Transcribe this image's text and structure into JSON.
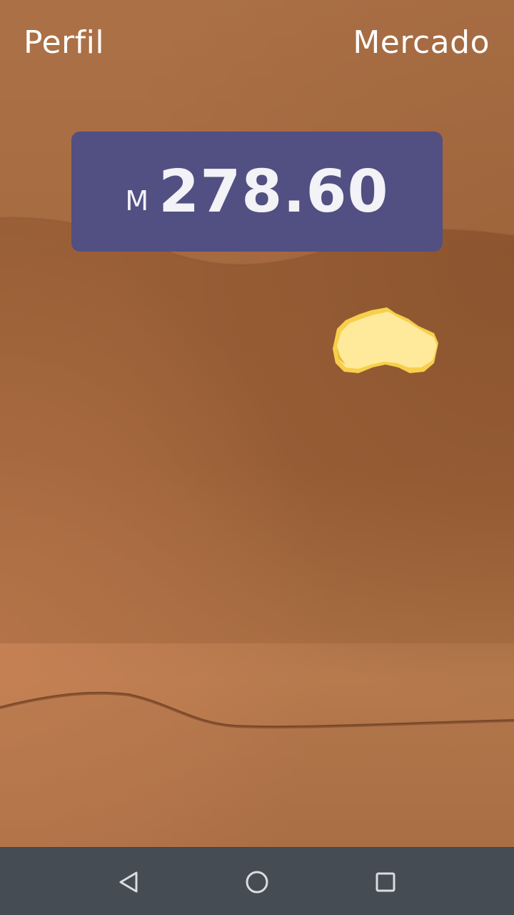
{
  "header": {
    "left_link": "Perfil",
    "right_link": "Mercado"
  },
  "balance": {
    "currency_symbol": "M",
    "amount": "278.60"
  },
  "colors": {
    "balance_box": "#524f82",
    "nugget_light": "#ffe99a",
    "nugget_dark": "#f7cf4a",
    "nav_bar": "#454c53"
  },
  "icons": {
    "nugget": "gold-nugget-icon",
    "back": "back-triangle-icon",
    "home": "home-circle-icon",
    "recent": "recent-apps-square-icon"
  }
}
